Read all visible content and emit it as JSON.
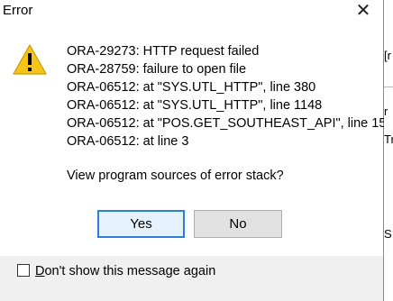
{
  "window": {
    "title": "Error",
    "close_glyph": "✕"
  },
  "messages": [
    "ORA-29273: HTTP request failed",
    "ORA-28759: failure to open file",
    "ORA-06512: at \"SYS.UTL_HTTP\", line 380",
    "ORA-06512: at \"SYS.UTL_HTTP\", line 1148",
    "ORA-06512: at \"POS.GET_SOUTHEAST_API\", line 15",
    "ORA-06512: at line 3"
  ],
  "question": "View program sources of error stack?",
  "buttons": {
    "yes": "Yes",
    "no": "No"
  },
  "checkbox": {
    "label_first": "D",
    "label_rest": "on't show this message again",
    "checked": false
  },
  "background_fragments": {
    "frag1": "[r",
    "frag2": "r",
    "frag3": "Tr",
    "frag4": "S"
  },
  "colors": {
    "warning_yellow": "#f5c518",
    "default_button_border": "#2a7fd6"
  },
  "icons": {
    "warning": "warning-icon",
    "close": "close-icon"
  }
}
